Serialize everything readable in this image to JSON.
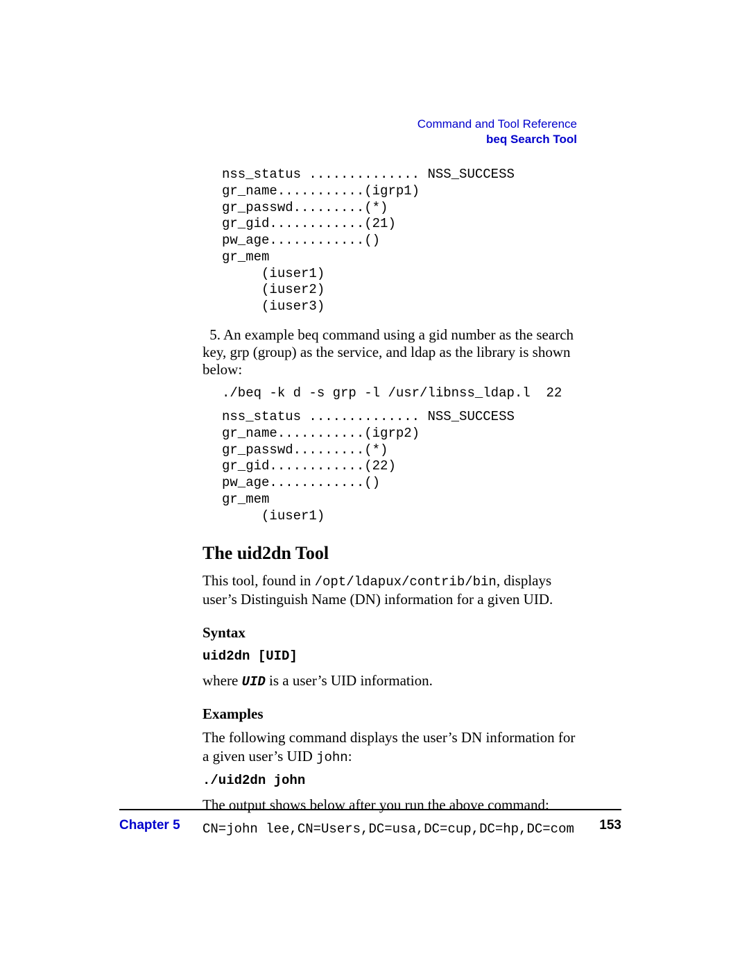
{
  "header": {
    "line1": "Command and Tool Reference",
    "line2": "beq Search Tool"
  },
  "code_block_1": "nss_status .............. NSS_SUCCESS\ngr_name...........(igrp1)\ngr_passwd.........(*)\ngr_gid............(21)\npw_age............()\ngr_mem\n     (iuser1)\n     (iuser2)\n     (iuser3)",
  "list_item_5": {
    "num": "5.",
    "text": "An example beq command using a gid number as the search key, grp (group) as the service, and ldap as the library is shown below:"
  },
  "code_block_2a": "./beq -k d -s grp -l /usr/libnss_ldap.l  22",
  "code_block_2b": "nss_status .............. NSS_SUCCESS\ngr_name...........(igrp2)\ngr_passwd.........(*)\ngr_gid............(22)\npw_age............()\ngr_mem\n     (iuser1)",
  "section_title": "The uid2dn Tool",
  "tool_intro": {
    "prefix": "This tool, found in ",
    "path": "/opt/ldapux/contrib/bin",
    "suffix": ", displays user’s Distinguish Name (DN) information for a given UID."
  },
  "syntax": {
    "heading": "Syntax",
    "usage": "uid2dn [UID]",
    "where_prefix": "where ",
    "uid_var": "UID",
    "where_suffix": " is a user’s UID information."
  },
  "examples": {
    "heading": "Examples",
    "intro_prefix": "The following command displays the user’s DN information for a given user’s UID ",
    "uid_example": "john",
    "intro_suffix": ":",
    "cmd": "./uid2dn john",
    "output_intro": "The output shows below after you run the above command:",
    "output": "CN=john lee,CN=Users,DC=usa,DC=cup,DC=hp,DC=com"
  },
  "footer": {
    "chapter": "Chapter 5",
    "page": "153"
  }
}
